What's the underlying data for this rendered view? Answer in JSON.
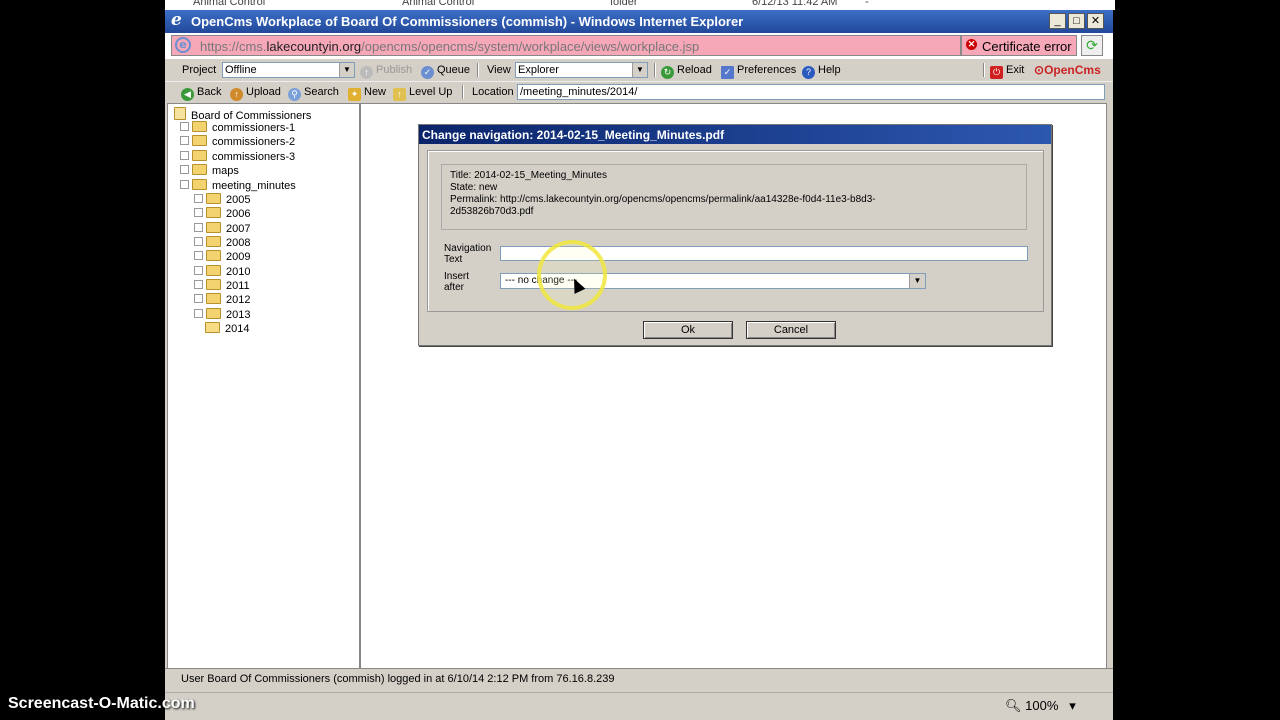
{
  "background_row": {
    "c1": "Animal Control",
    "c2": "Animal Control",
    "c3": "folder",
    "c4": "6/12/13 11:42 AM",
    "c5": "-"
  },
  "window": {
    "title": "OpenCms Workplace of Board Of Commissioners (commish) - Windows Internet Explorer"
  },
  "address": {
    "url_prefix": "https://cms.",
    "url_domain": "lakecountyin.org",
    "url_rest": "/opencms/opencms/system/workplace/views/workplace.jsp",
    "cert_error": "Certificate error"
  },
  "toolbar1": {
    "project_label": "Project",
    "project_value": "Offline",
    "publish": "Publish",
    "queue": "Queue",
    "view_label": "View",
    "view_value": "Explorer",
    "reload": "Reload",
    "preferences": "Preferences",
    "help": "Help",
    "exit": "Exit",
    "brand": "OpenCms"
  },
  "toolbar2": {
    "back": "Back",
    "upload": "Upload",
    "search": "Search",
    "new": "New",
    "level_up": "Level Up",
    "location_label": "Location",
    "location_value": "/meeting_minutes/2014/"
  },
  "tree": {
    "root": "Board of Commissioners",
    "items": [
      "commissioners-1",
      "commissioners-2",
      "commissioners-3",
      "maps",
      "meeting_minutes"
    ],
    "years": [
      "2005",
      "2006",
      "2007",
      "2008",
      "2009",
      "2010",
      "2011",
      "2012",
      "2013",
      "2014"
    ]
  },
  "dialog": {
    "title": "Change navigation: 2014-02-15_Meeting_Minutes.pdf",
    "info_title": "Title: 2014-02-15_Meeting_Minutes",
    "info_state": "State: new",
    "info_permalink1": "Permalink: http://cms.lakecountyin.org/opencms/opencms/permalink/aa14328e-f0d4-11e3-b8d3-",
    "info_permalink2": "2d53826b70d3.pdf",
    "nav_label1": "Navigation",
    "nav_label2": "Text",
    "nav_value": "",
    "insert_label1": "Insert",
    "insert_label2": "after",
    "insert_value": "--- no change ---",
    "ok": "Ok",
    "cancel": "Cancel"
  },
  "status": {
    "text": "User Board Of Commissioners (commish) logged in at 6/10/14 2:12 PM from 76.16.8.239"
  },
  "ie_status": {
    "zoom": "100%"
  },
  "watermark": "Screencast-O-Matic.com",
  "colors": {
    "title_bar": "#22489a",
    "dialog_title": "#0a246a",
    "cert_error_bg": "#f7a8b8",
    "halo": "#f0e63c"
  }
}
